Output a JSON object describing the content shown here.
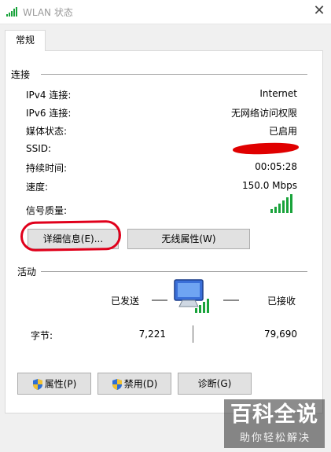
{
  "window": {
    "title": "WLAN 状态",
    "close_glyph": "✕"
  },
  "tabs": [
    {
      "label": "常规"
    }
  ],
  "connection": {
    "heading": "连接",
    "ipv4_label": "IPv4 连接:",
    "ipv4_value": "Internet",
    "ipv6_label": "IPv6 连接:",
    "ipv6_value": "无网络访问权限",
    "media_label": "媒体状态:",
    "media_value": "已启用",
    "ssid_label": "SSID:",
    "duration_label": "持续时间:",
    "duration_value": "00:05:28",
    "speed_label": "速度:",
    "speed_value": "150.0 Mbps",
    "signal_label": "信号质量:",
    "signal_icon": "signal-bars-icon"
  },
  "buttons": {
    "details": "详细信息(E)...",
    "wireless": "无线属性(W)"
  },
  "activity": {
    "heading": "活动",
    "sent_label": "已发送",
    "received_label": "已接收",
    "bytes_label": "字节:",
    "bytes_sent": "7,221",
    "bytes_received": "79,690",
    "network_icon": "network-computer-icon"
  },
  "footer": {
    "properties": "属性(P)",
    "disable": "禁用(D)",
    "diagnose": "诊断(G)"
  },
  "watermark": {
    "title": "百科全说",
    "subtitle": "助你轻松解决"
  },
  "colors": {
    "signal_green": "#19a33b",
    "annotation_red": "#e0001b"
  }
}
